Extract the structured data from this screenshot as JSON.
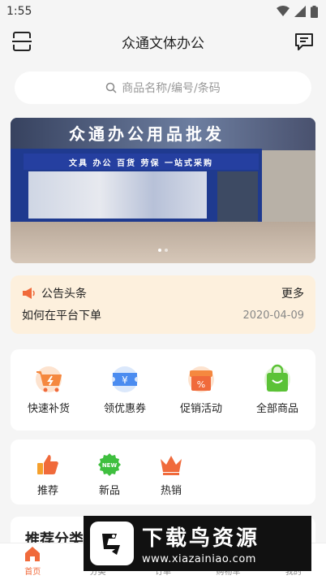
{
  "status": {
    "time": "1:55"
  },
  "header": {
    "title": "众通文体办公"
  },
  "search": {
    "placeholder": "商品名称/编号/条码"
  },
  "banner": {
    "sign_text": "众通办公用品批发",
    "store_sign": "文具 办公 百货 劳保 一站式采购",
    "active_dot": 0,
    "dot_count": 2
  },
  "notice": {
    "label": "公告头条",
    "more": "更多",
    "message": "如何在平台下单",
    "date": "2020-04-09"
  },
  "quick_menu": [
    {
      "label": "快速补货",
      "icon": "cart-bolt-icon"
    },
    {
      "label": "领优惠券",
      "icon": "coupon-yen-icon"
    },
    {
      "label": "促销活动",
      "icon": "gift-percent-icon"
    },
    {
      "label": "全部商品",
      "icon": "shopping-bag-icon"
    }
  ],
  "category_menu": [
    {
      "label": "推荐",
      "icon": "thumbs-up-icon"
    },
    {
      "label": "新品",
      "icon": "new-badge-icon",
      "badge": "NEW"
    },
    {
      "label": "热销",
      "icon": "crown-icon"
    }
  ],
  "section": {
    "title": "推荐分类"
  },
  "tabbar": [
    {
      "label": "首页",
      "active": true
    },
    {
      "label": "分类",
      "active": false
    },
    {
      "label": "订单",
      "active": false
    },
    {
      "label": "购物车",
      "active": false
    },
    {
      "label": "我的",
      "active": false
    }
  ],
  "watermark": {
    "title": "下载鸟资源",
    "url": "www.xiazainiao.com"
  },
  "colors": {
    "accent": "#f06a3b",
    "notice_bg": "#fdf0dd",
    "page_bg": "#f5f5f5"
  }
}
